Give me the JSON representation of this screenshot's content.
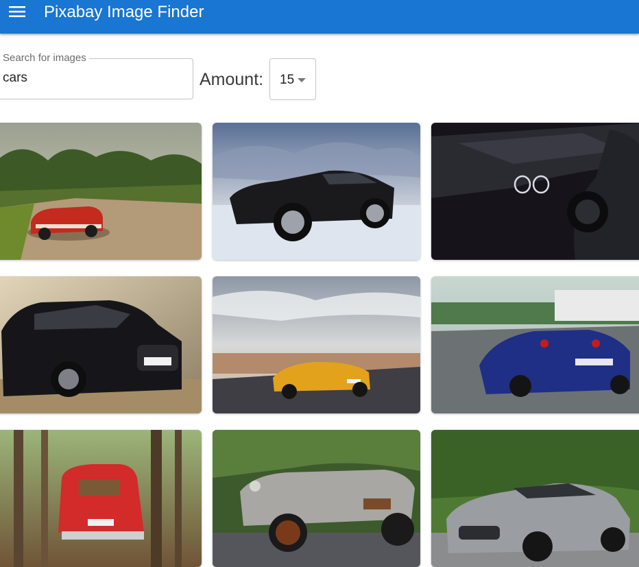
{
  "appbar": {
    "title": "Pixabay Image Finder",
    "color": "#1976d2",
    "menu_icon": "hamburger-menu-icon"
  },
  "search": {
    "label": "Search for images",
    "value": "cars"
  },
  "amount": {
    "label": "Amount:",
    "selected": "15",
    "caret_icon": "dropdown-caret-icon"
  },
  "results": [
    {
      "subject": "red vintage convertible on dirt road"
    },
    {
      "subject": "black mustang on snow"
    },
    {
      "subject": "dark sports car front detail"
    },
    {
      "subject": "black audi hatchback"
    },
    {
      "subject": "orange lamborghini in desert"
    },
    {
      "subject": "blue ferrari on race track"
    },
    {
      "subject": "red fiat 500 in forest"
    },
    {
      "subject": "silver classic roadster"
    },
    {
      "subject": "silver mercedes amg gt"
    }
  ]
}
